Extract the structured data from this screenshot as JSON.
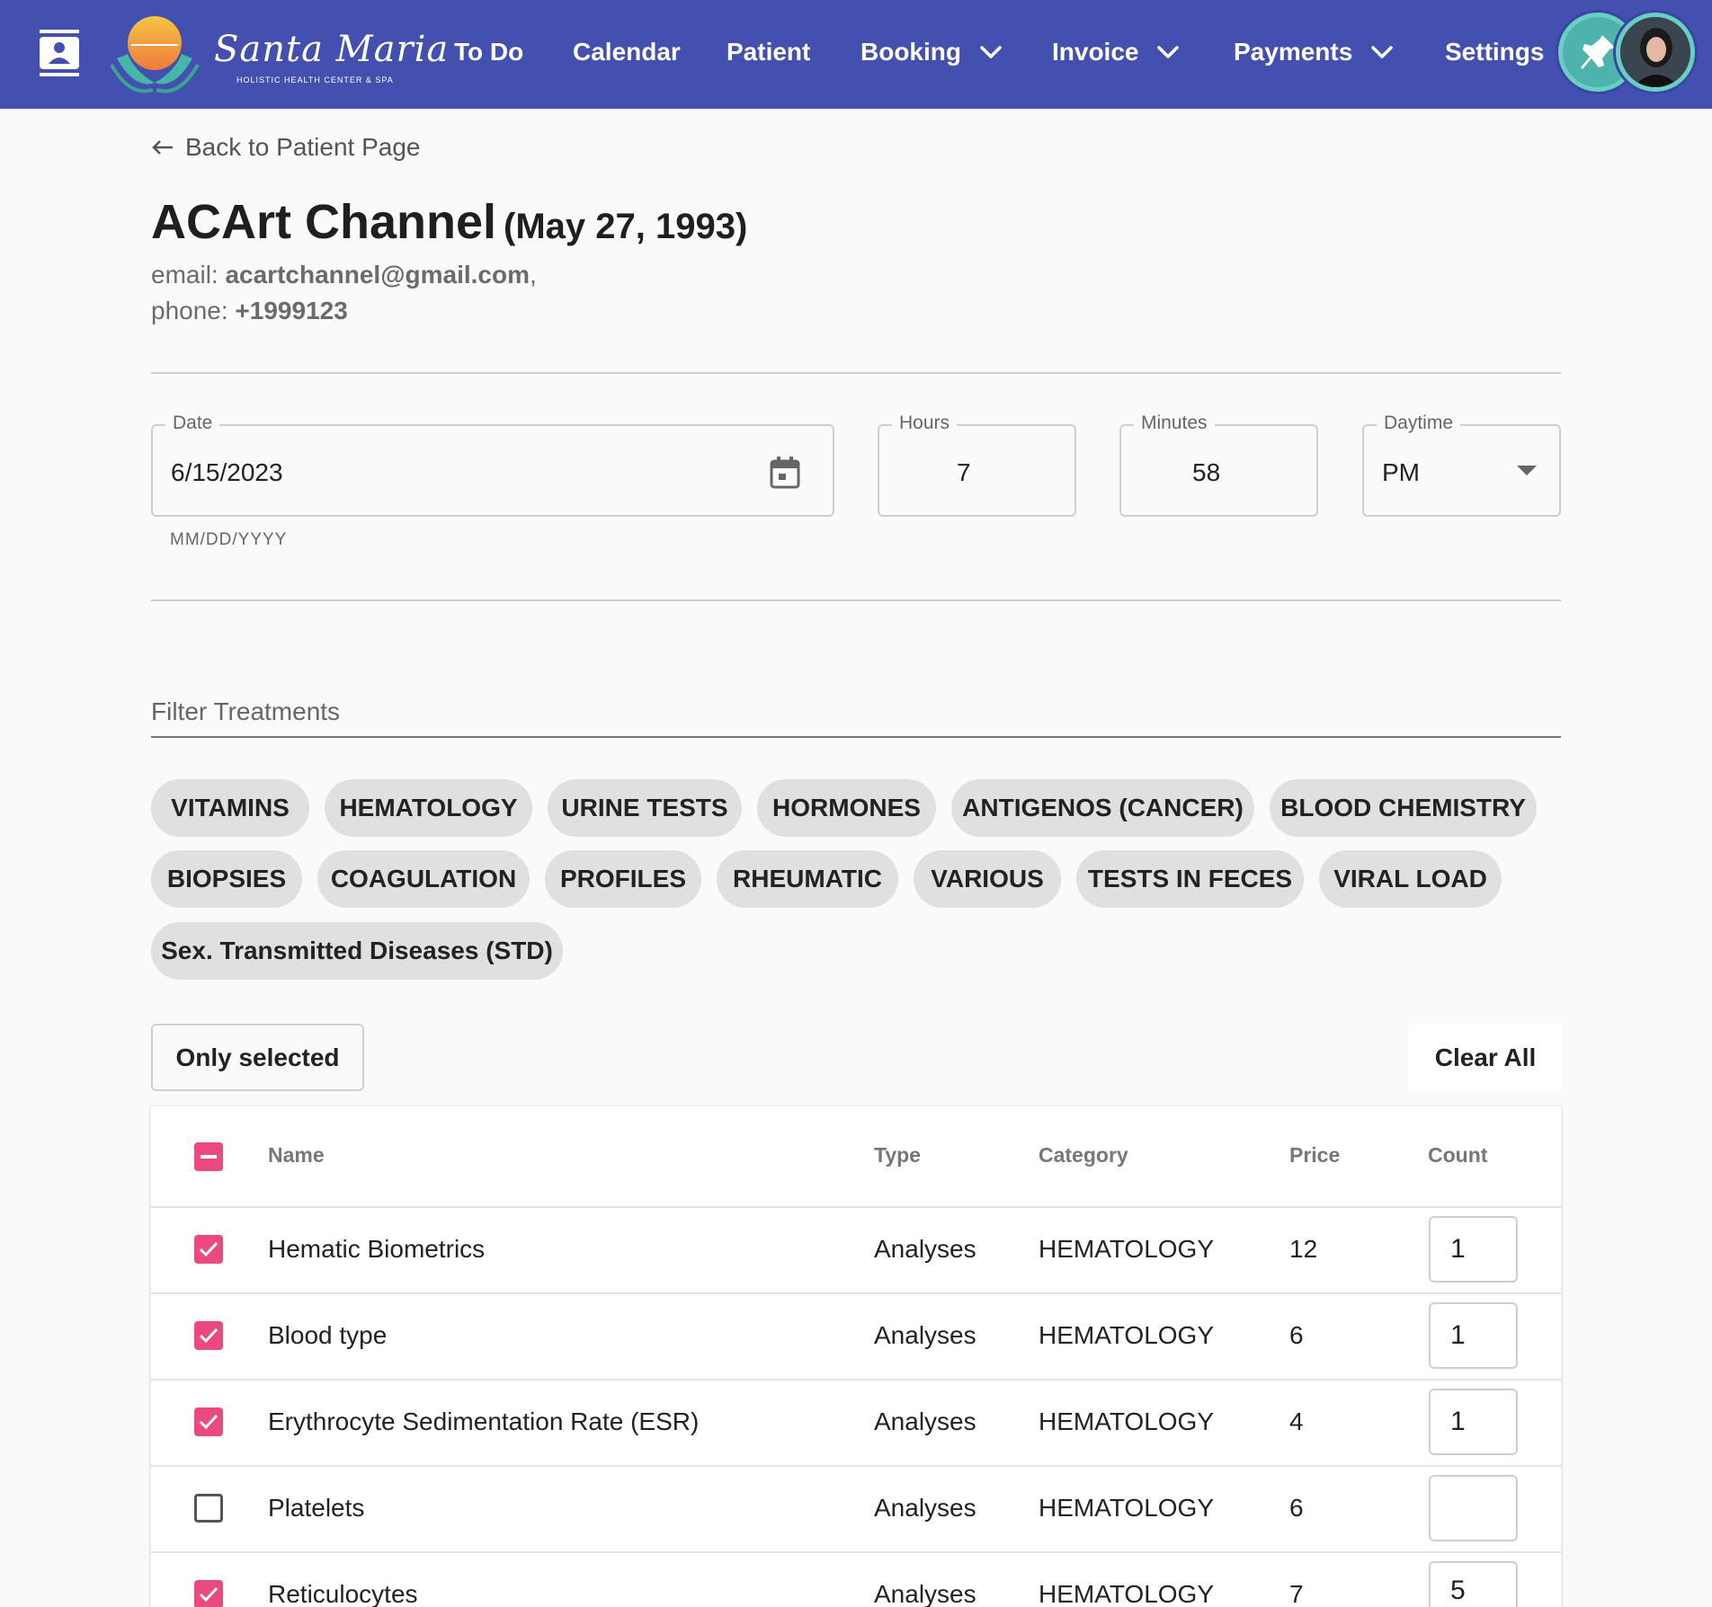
{
  "colors": {
    "nav_bg": "#4350b0",
    "accent": "#ec4a7e",
    "chip_bg": "#e0e0e0",
    "pin_teal": "#4fb3ad"
  },
  "nav": {
    "contacts_icon": "contacts-icon",
    "logo": {
      "name": "Santa Maria",
      "subtitle": "HOLISTIC HEALTH CENTER & SPA"
    },
    "items": [
      {
        "label": "To Do"
      },
      {
        "label": "Calendar"
      },
      {
        "label": "Patient"
      },
      {
        "label": "Booking",
        "icon": "chevron-down-icon"
      },
      {
        "label": "Invoice",
        "icon": "chevron-down-icon"
      },
      {
        "label": "Payments",
        "icon": "chevron-down-icon"
      },
      {
        "label": "Settings"
      }
    ],
    "pin_icon": "pin-icon"
  },
  "back_link": "Back to Patient Page",
  "patient": {
    "name": "ACArt Channel",
    "dob": "(May 27, 1993)",
    "email_label": "email: ",
    "email": "acartchannel@gmail.com",
    "email_suffix": ",",
    "phone_label": "phone: ",
    "phone": "+1999123"
  },
  "appointment": {
    "date_label": "Date",
    "date_value": "6/15/2023",
    "date_helper": "MM/DD/YYYY",
    "hours_label": "Hours",
    "hours_value": "7",
    "minutes_label": "Minutes",
    "minutes_value": "58",
    "daytime_label": "Daytime",
    "daytime_value": "PM"
  },
  "filter": {
    "label": "Filter Treatments",
    "chips": [
      "VITAMINS",
      "HEMATOLOGY",
      "URINE TESTS",
      "HORMONES",
      "ANTIGENOS (CANCER)",
      "BLOOD CHEMISTRY",
      "BIOPSIES",
      "COAGULATION",
      "PROFILES",
      "RHEUMATIC",
      "VARIOUS",
      "TESTS IN FECES",
      "VIRAL LOAD",
      "Sex. Transmitted Diseases (STD)"
    ]
  },
  "actions": {
    "only_selected": "Only selected",
    "clear_all": "Clear All"
  },
  "table": {
    "headers": {
      "name": "Name",
      "type": "Type",
      "category": "Category",
      "price": "Price",
      "count": "Count"
    },
    "select_all_state": "indeterminate",
    "rows": [
      {
        "checked": true,
        "name": "Hematic Biometrics",
        "type": "Analyses",
        "category": "HEMATOLOGY",
        "price": "12",
        "count": "1"
      },
      {
        "checked": true,
        "name": "Blood type",
        "type": "Analyses",
        "category": "HEMATOLOGY",
        "price": "6",
        "count": "1"
      },
      {
        "checked": true,
        "name": "Erythrocyte Sedimentation Rate (ESR)",
        "type": "Analyses",
        "category": "HEMATOLOGY",
        "price": "4",
        "count": "1"
      },
      {
        "checked": false,
        "name": "Platelets",
        "type": "Analyses",
        "category": "HEMATOLOGY",
        "price": "6",
        "count": ""
      },
      {
        "checked": true,
        "name": "Reticulocytes",
        "type": "Analyses",
        "category": "HEMATOLOGY",
        "price": "7",
        "count": "5"
      }
    ]
  }
}
